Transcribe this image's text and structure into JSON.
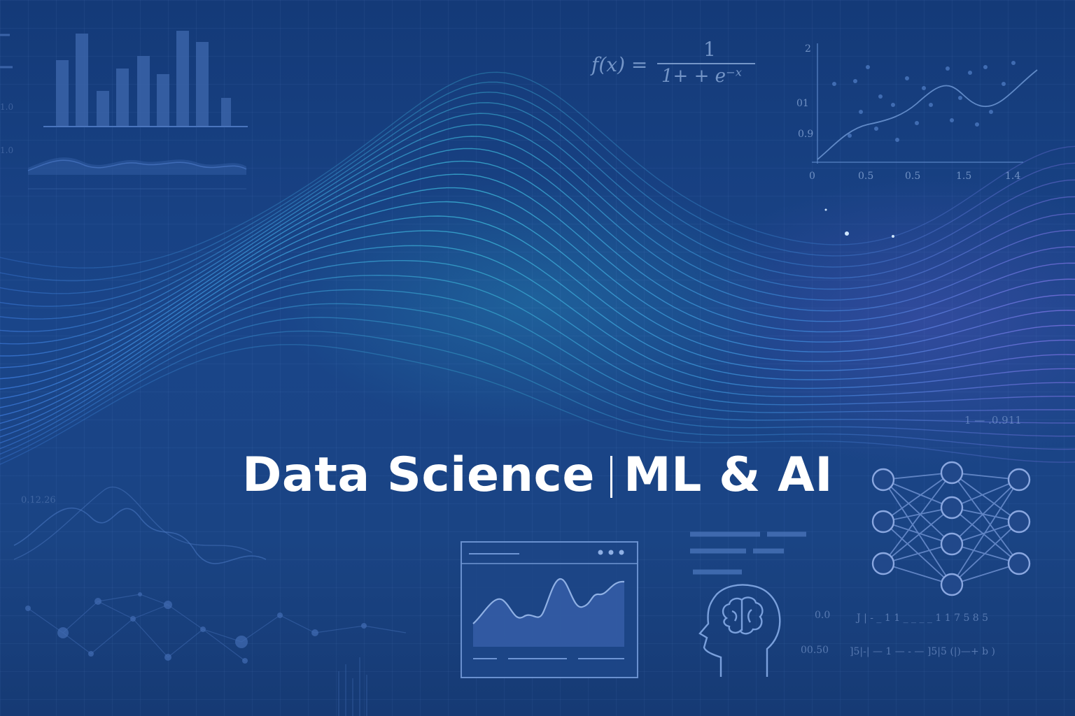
{
  "headline": {
    "left": "Data Science",
    "right": "ML & AI"
  },
  "formula": {
    "lhs": "f(x) =",
    "numerator": "1",
    "denominator": "1+ + e⁻ˣ"
  },
  "plot_ticks": {
    "y": [
      "2",
      "01",
      "0.9"
    ],
    "x": [
      "0",
      "0.5",
      "0.5",
      "1.5",
      "1.4"
    ]
  },
  "scatter_text": {
    "right_mid": "1 — .0.911",
    "left_mid": "0.12.26",
    "left_top_a": "1.0",
    "left_top_b": "1.0",
    "bottom_right_a": "0.0",
    "bottom_right_b": "00.50",
    "bottom_right_c": "J | - _ 1 1 _ _ _ _ 1 1 7 5 8 5",
    "bottom_right_d": "]5|-| — 1 — - — ]5|5 (|)—+ b )"
  },
  "icons": [
    "bar-chart-icon",
    "line-chart-window-icon",
    "brain-head-icon",
    "neural-network-icon"
  ],
  "colors": {
    "background": "#183f7e",
    "headline": "#ffffff",
    "wave_cyan": "#38b6d8",
    "wave_purple": "#7b6fe0"
  }
}
